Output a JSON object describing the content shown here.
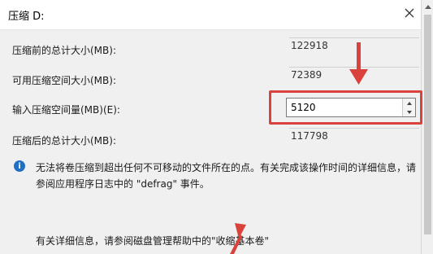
{
  "window": {
    "title": "压缩 D:",
    "close_icon": "close-icon"
  },
  "fields": {
    "total_before_label": "压缩前的总计大小(MB):",
    "total_before_value": "122918",
    "available_label": "可用压缩空间大小(MB):",
    "available_value": "72389",
    "input_label": "输入压缩空间量(MB)(E):",
    "input_value": "5120",
    "total_after_label": "压缩后的总计大小(MB):",
    "total_after_value": "117798"
  },
  "info": {
    "icon": "info-icon",
    "line1": "无法将卷压缩到超出任何不可移动的文件所在的点。有关完成该操作时间的详细信息，请",
    "line2": "参阅应用程序日志中的 \"defrag\" 事件。"
  },
  "help": {
    "text": "有关详细信息，请参阅磁盘管理帮助中的\"收缩基本卷\""
  },
  "colors": {
    "highlight": "#d9433b",
    "info": "#1f6fc7"
  }
}
